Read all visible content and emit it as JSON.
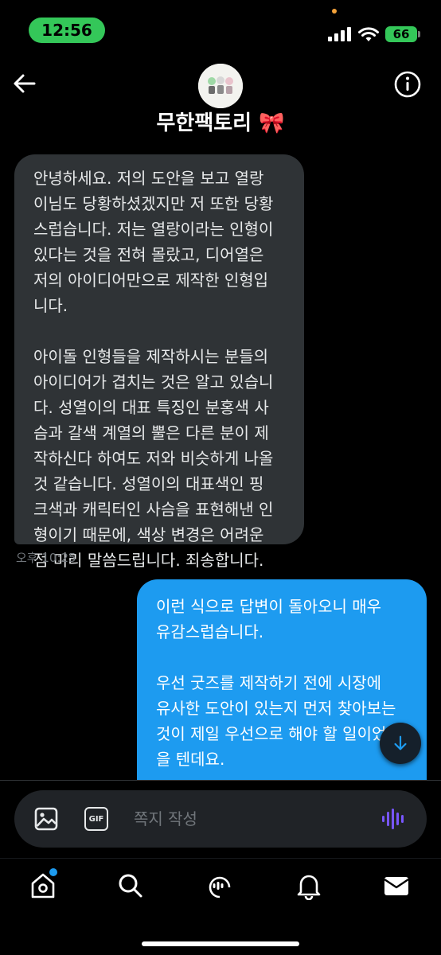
{
  "status_bar": {
    "time": "12:56",
    "battery": "66",
    "accent_color": "#34c759"
  },
  "header": {
    "title": "무한팩토리 🎀",
    "back_icon": "arrow-left-icon",
    "info_icon": "info-icon"
  },
  "messages": [
    {
      "direction": "incoming",
      "text": "안녕하세요. 저의 도안을 보고 열랑\n이님도 당황하셨겠지만 저 또한 당황\n스럽습니다. 저는 열랑이라는 인형이\n있다는 것을 전혀 몰랐고, 디어열은\n저의 아이디어만으로 제작한 인형입\n니다.\n\n아이돌 인형들을 제작하시는 분들의\n아이디어가 겹치는 것은 알고 있습니\n다. 성열이의 대표 특징인 분홍색 사\n슴과 갈색 계열의 뿔은 다른 분이 제\n작하신다 하여도 저와 비슷하게 나올\n것 같습니다. 성열이의 대표색인 핑\n크색과 캐릭터인 사슴을 표현해낸 인\n형이기 때문에, 색상 변경은 어려운\n점 미리 말씀드립니다. 죄송합니다.",
      "time": "오후 10:25"
    },
    {
      "direction": "outgoing",
      "text": "이런 식으로 답변이 돌아오니 매우\n유감스럽습니다.\n\n우선 굿즈를 제작하기 전에 시장에\n유사한 도안이 있는지 먼저 찾아보는\n것이 제일 우선으로 해야 할 일이었\n을 텐데요.\n\n또한 이미 판매 중인 다른 제작자 인형"
    }
  ],
  "composer": {
    "placeholder": "쪽지 작성",
    "gif_label": "GIF"
  },
  "bottom_nav": [
    {
      "name": "home-icon",
      "has_badge": true
    },
    {
      "name": "search-icon"
    },
    {
      "name": "spaces-icon"
    },
    {
      "name": "bell-icon"
    },
    {
      "name": "mail-icon"
    }
  ],
  "colors": {
    "incoming_bubble": "#2f3336",
    "outgoing_bubble": "#1d9bf0",
    "voice_accent": "#7856ff"
  }
}
